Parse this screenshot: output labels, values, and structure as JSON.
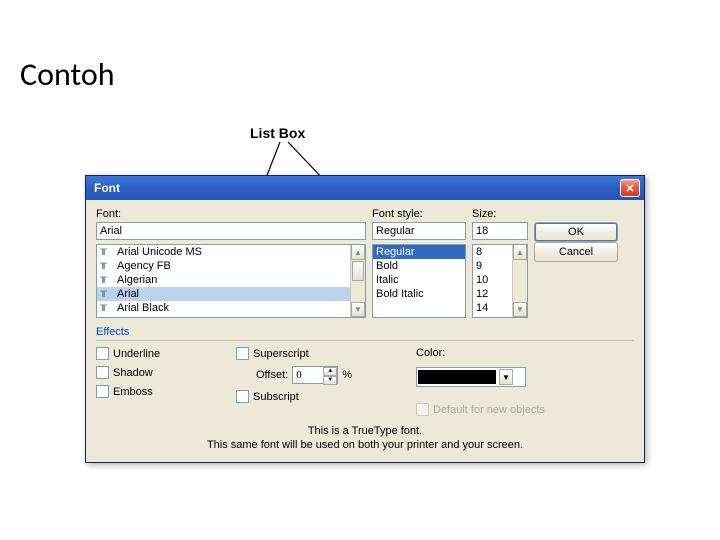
{
  "slide": {
    "title": "Contoh",
    "annotation": "List Box"
  },
  "dialog": {
    "title": "Font"
  },
  "labels": {
    "font": "Font:",
    "style": "Font style:",
    "size": "Size:",
    "effects": "Effects",
    "color": "Color:",
    "offset": "Offset:",
    "percent": "%"
  },
  "values": {
    "font": "Arial",
    "style": "Regular",
    "size": "18",
    "offset": "0"
  },
  "fontList": [
    "Arial Unicode MS",
    "Agency FB",
    "Algerian",
    "Arial",
    "Arial Black"
  ],
  "styleList": [
    "Regular",
    "Bold",
    "Italic",
    "Bold Italic"
  ],
  "sizeList": [
    "8",
    "9",
    "10",
    "12",
    "14"
  ],
  "buttons": {
    "ok": "OK",
    "cancel": "Cancel"
  },
  "effects": {
    "underline": "Underline",
    "shadow": "Shadow",
    "emboss": "Emboss",
    "superscript": "Superscript",
    "subscript": "Subscript",
    "defaultnew": "Default for new objects"
  },
  "footer": {
    "l1": "This is a TrueType font.",
    "l2": "This same font will be used on both your printer and your screen."
  }
}
